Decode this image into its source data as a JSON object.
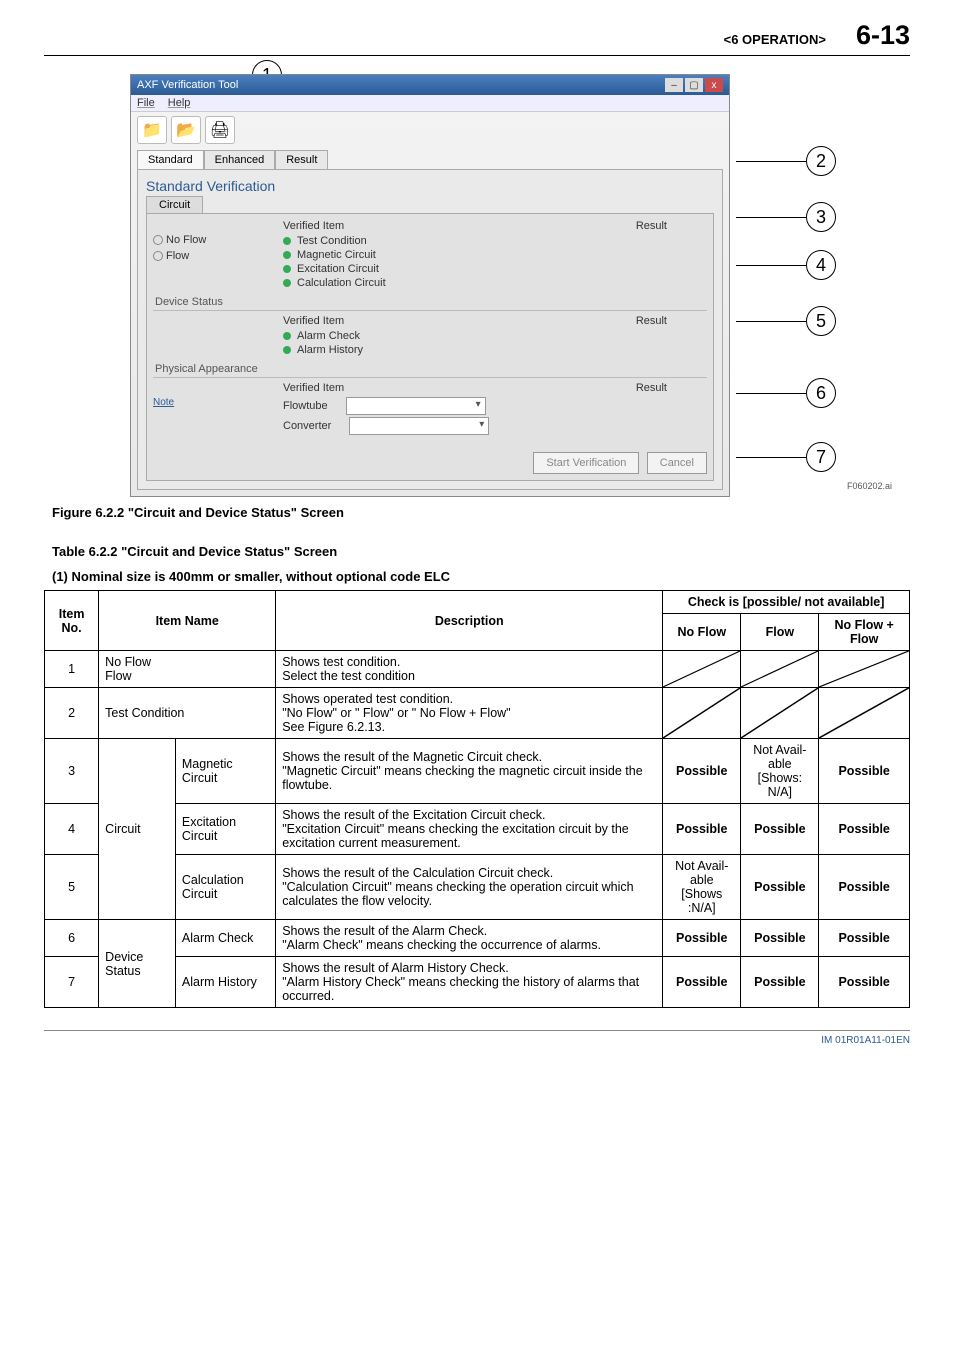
{
  "header": {
    "section": "<6  OPERATION>",
    "page": "6-13"
  },
  "app": {
    "title": "AXF Verification Tool",
    "menu": {
      "file": "File",
      "help": "Help"
    },
    "tabs": {
      "standard": "Standard",
      "enhanced": "Enhanced",
      "result": "Result"
    },
    "panelTitle": "Standard Verification",
    "subtabCircuit": "Circuit",
    "verifiedItemHdr": "Verified Item",
    "resultHdr": "Result",
    "radios": {
      "noflow": "No Flow",
      "flow": "Flow"
    },
    "circuitItems": {
      "testCondition": "Test Condition",
      "magnetic": "Magnetic Circuit",
      "excitation": "Excitation Circuit",
      "calculation": "Calculation Circuit"
    },
    "deviceStatusLabel": "Device Status",
    "deviceItems": {
      "alarmCheck": "Alarm Check",
      "alarmHistory": "Alarm History"
    },
    "physicalLabel": "Physical Appearance",
    "noteLink": "Note",
    "physicalItems": {
      "flowtube": "Flowtube",
      "converter": "Converter"
    },
    "buttons": {
      "start": "Start Verification",
      "cancel": "Cancel"
    },
    "figId": "F060202.ai"
  },
  "captions": {
    "fig": "Figure 6.2.2 \"Circuit and Device Status\" Screen",
    "tbl": "Table 6.2.2 \"Circuit and Device Status\" Screen",
    "sub": "(1) Nominal size is 400mm or smaller, without optional code ELC"
  },
  "tableHeaders": {
    "itemNo": "Item No.",
    "itemName": "Item Name",
    "description": "Description",
    "checkSpan": "Check is [possible/ not available]",
    "noFlow": "No Flow",
    "flow": "Flow",
    "both": "No Flow + Flow"
  },
  "tableRows": [
    {
      "no": "1",
      "name1": "No Flow\nFlow",
      "name2": "",
      "desc": "Shows test condition.\nSelect the test condition",
      "c1": "diag",
      "c2": "diag",
      "c3": "diag"
    },
    {
      "no": "2",
      "name1": "Test Condition",
      "name2": "",
      "desc": "Shows operated test condition.\n\"No Flow\" or \" Flow\" or \" No Flow + Flow\"\nSee Figure 6.2.13.",
      "c1": "diag",
      "c2": "diag",
      "c3": "diag"
    },
    {
      "no": "3",
      "group": "Circuit",
      "name2": "Magnetic Circuit",
      "desc": "Shows the result of the Magnetic Circuit check.\n\"Magnetic Circuit\" means checking the magnetic circuit inside the flowtube.",
      "c1": "Possible",
      "c2": "Not Available\n[Shows: N/A]",
      "c3": "Possible"
    },
    {
      "no": "4",
      "name2": "Excitation Circuit",
      "desc": "Shows the result of the Excitation Circuit check.\n\"Excitation Circuit\" means checking the excitation circuit by the excitation current measurement.",
      "c1": "Possible",
      "c2": "Possible",
      "c3": "Possible"
    },
    {
      "no": "5",
      "name2": "Calculation Circuit",
      "desc": "Shows the result of the Calculation Circuit check.\n\"Calculation Circuit\" means checking the operation circuit which calculates the flow velocity.",
      "c1": "Not Available\n[Shows :N/A]",
      "c2": "Possible",
      "c3": "Possible"
    },
    {
      "no": "6",
      "group": "Device Status",
      "name2": "Alarm Check",
      "desc": "Shows the result of the Alarm Check.\n\"Alarm Check\" means checking the occurrence of alarms.",
      "c1": "Possible",
      "c2": "Possible",
      "c3": "Possible"
    },
    {
      "no": "7",
      "name2": "Alarm History",
      "desc": "Shows the result of Alarm History Check.\n\"Alarm History Check\" means checking the history of alarms that occurred.",
      "c1": "Possible",
      "c2": "Possible",
      "c3": "Possible"
    }
  ],
  "footer": "IM 01R01A11-01EN"
}
